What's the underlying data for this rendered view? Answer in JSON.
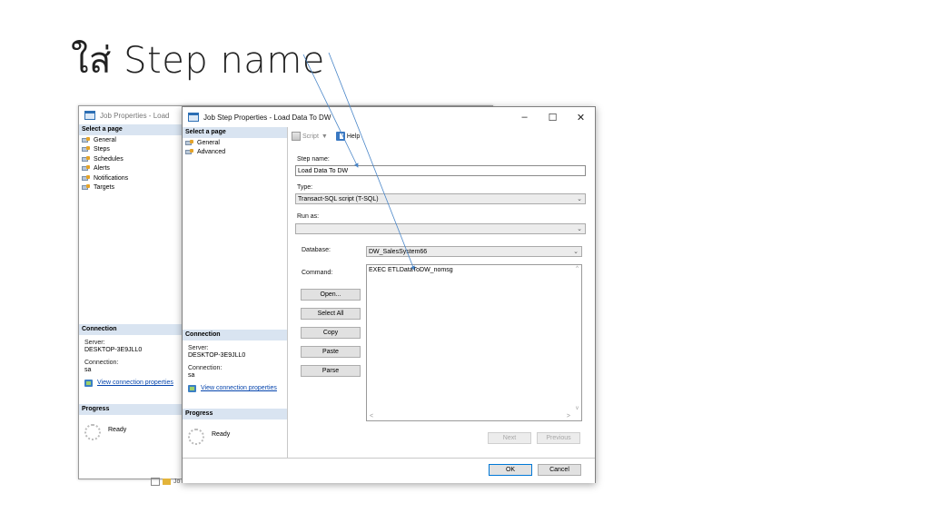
{
  "slide": {
    "title": "ใส่ Step name"
  },
  "back_window": {
    "title": "Job Properties - Load",
    "select_page_header": "Select a page",
    "pages": [
      "General",
      "Steps",
      "Schedules",
      "Alerts",
      "Notifications",
      "Targets"
    ],
    "connection_header": "Connection",
    "server_label": "Server:",
    "server_value": "DESKTOP-3E9JLL0",
    "connection_label": "Connection:",
    "connection_value": "sa",
    "view_connection_link": "View connection properties",
    "progress_header": "Progress",
    "progress_status": "Ready",
    "tree_stub": "Jo"
  },
  "front_window": {
    "title": "Job Step Properties - Load Data To DW",
    "controls": {
      "minimize": "–",
      "maximize": "☐",
      "close": "✕"
    },
    "select_page_header": "Select a page",
    "pages": [
      "General",
      "Advanced"
    ],
    "toolbar": {
      "script_label": "Script",
      "help_label": "Help"
    },
    "step_name_label": "Step name:",
    "step_name_value": "Load Data To DW",
    "type_label": "Type:",
    "type_value": "Transact-SQL script (T-SQL)",
    "run_as_label": "Run as:",
    "run_as_value": "",
    "database_label": "Database:",
    "database_value": "DW_SalesSystem66",
    "command_label": "Command:",
    "command_value": "EXEC ETLDataToDW_nomsg",
    "side_buttons": {
      "open": "Open...",
      "select_all": "Select All",
      "copy": "Copy",
      "paste": "Paste",
      "parse": "Parse"
    },
    "nav_buttons": {
      "next": "Next",
      "previous": "Previous"
    },
    "ok": "OK",
    "cancel": "Cancel",
    "connection_header": "Connection",
    "server_label": "Server:",
    "server_value": "DESKTOP-3E9JLL0",
    "connection_label": "Connection:",
    "connection_value": "sa",
    "view_connection_link": "View connection properties",
    "progress_header": "Progress",
    "progress_status": "Ready"
  },
  "colors": {
    "accent": "#0078d7",
    "header_bg": "#d9e4f1",
    "arrow": "#4a86c8"
  }
}
